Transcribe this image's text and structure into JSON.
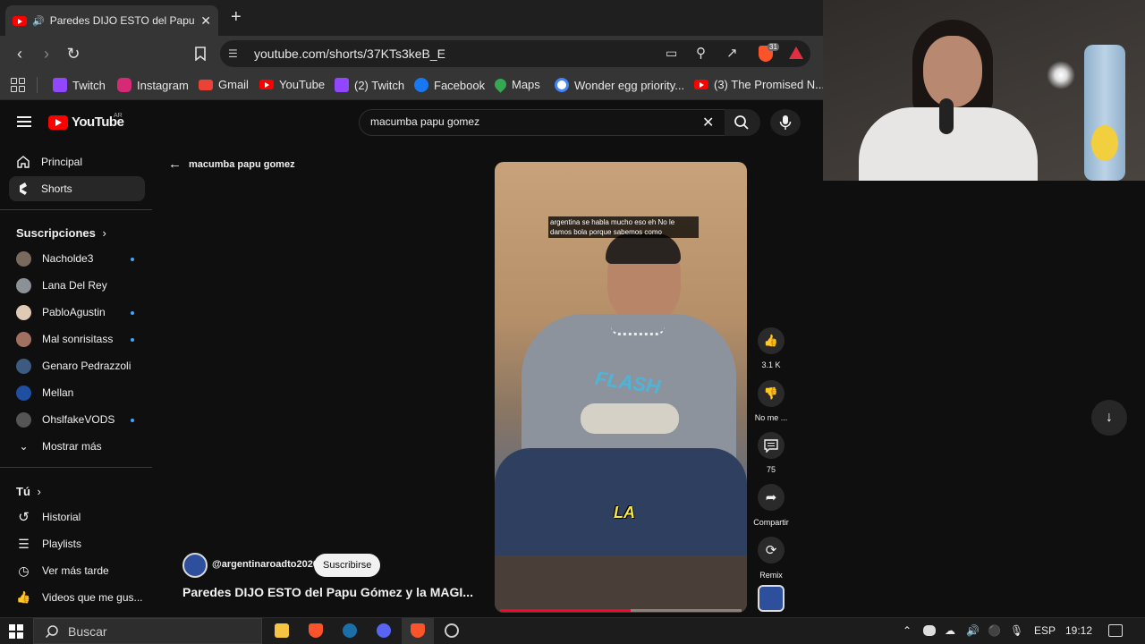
{
  "browser": {
    "tab_title": "Paredes DIJO ESTO del Papu G",
    "new_tab": "+",
    "url": "youtube.com/shorts/37KTs3keB_E",
    "brave_badge": "31",
    "bookmarks": [
      {
        "label": "Twitch",
        "color": "#9146ff"
      },
      {
        "label": "Instagram",
        "color": "#d62976"
      },
      {
        "label": "Gmail",
        "color": "#ea4335"
      },
      {
        "label": "YouTube",
        "color": "#ff0000"
      },
      {
        "label": "(2) Twitch",
        "color": "#9146ff"
      },
      {
        "label": "Facebook",
        "color": "#1877f2"
      },
      {
        "label": "Maps",
        "color": "#34a853"
      },
      {
        "label": "Wonder egg priority...",
        "color": "#4285f4"
      },
      {
        "label": "(3) The Promised N...",
        "color": "#ff0000"
      }
    ]
  },
  "youtube": {
    "logo_text": "YouTube",
    "logo_region": "AR",
    "search_query": "macumba papu gomez",
    "back_label": "macumba papu gomez",
    "nav": [
      {
        "label": "Principal"
      },
      {
        "label": "Shorts"
      }
    ],
    "subs_title": "Suscripciones",
    "subscriptions": [
      {
        "label": "Nacholde3",
        "color": "#7a6a5e",
        "dot": true
      },
      {
        "label": "Lana Del Rey",
        "color": "#8c9097",
        "dot": false
      },
      {
        "label": "PabloAgustin",
        "color": "#e0c9b5",
        "dot": true
      },
      {
        "label": "Mal sonrisitass",
        "color": "#a07060",
        "dot": true
      },
      {
        "label": "Genaro Pedrazzoli",
        "color": "#3d5a80",
        "dot": false
      },
      {
        "label": "Mellan",
        "color": "#1f4fa0",
        "dot": false
      },
      {
        "label": "OhslfakeVODS",
        "color": "#555555",
        "dot": true
      }
    ],
    "more_label": "Mostrar más",
    "you_title": "Tú",
    "you_items": [
      {
        "label": "Historial"
      },
      {
        "label": "Playlists"
      },
      {
        "label": "Ver más tarde"
      },
      {
        "label": "Videos que me gus..."
      }
    ],
    "short": {
      "caption": "argentina se habla mucho eso eh No le damos bola porque sabemos como",
      "overlay_word": "LA",
      "shirt_text": "FLASH",
      "channel": "@argentinaroadto2026",
      "subscribe": "Suscribirse",
      "title": "Paredes DIJO ESTO del Papu Gómez y la MAGI...",
      "progress": 0.54,
      "likes": "3.1 K",
      "dislike_label": "No me ...",
      "comments": "75",
      "share_label": "Compartir",
      "remix_label": "Remix"
    }
  },
  "taskbar": {
    "search_placeholder": "Buscar",
    "lang": "ESP",
    "time": "19:12"
  }
}
